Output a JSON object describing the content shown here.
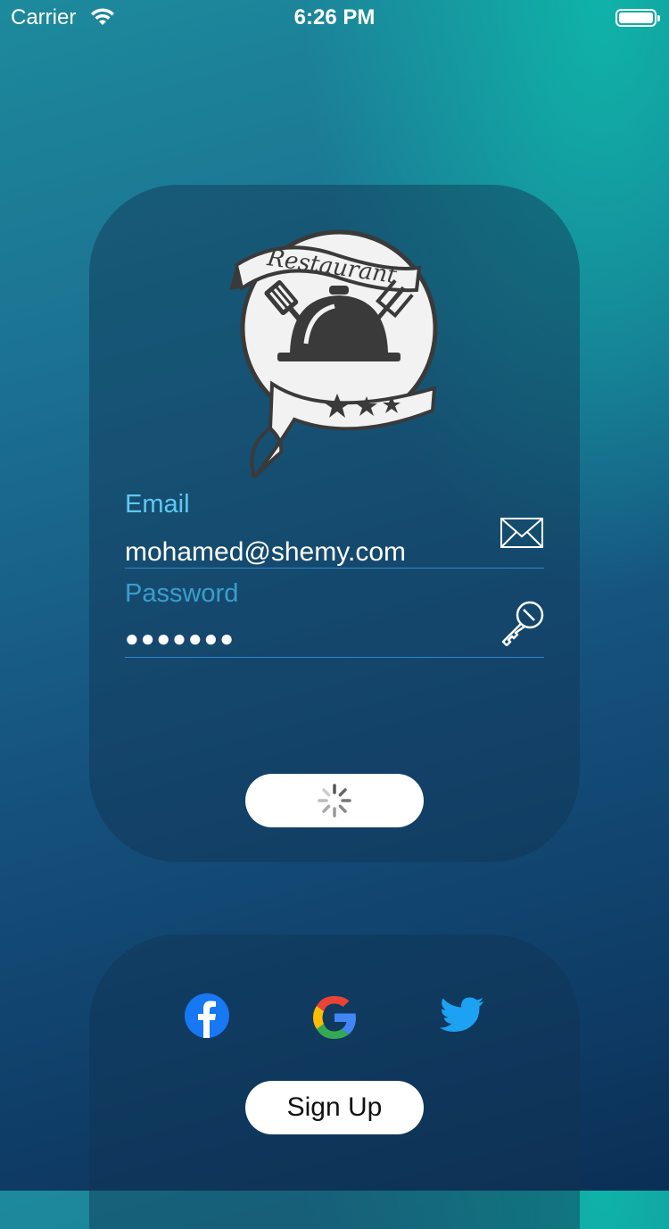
{
  "status_bar": {
    "carrier": "Carrier",
    "time": "6:26 PM"
  },
  "logo": {
    "icon": "restaurant-logo",
    "text": "Restaurant"
  },
  "login": {
    "email_label": "Email",
    "email_value": "mohamed@shemy.com",
    "password_label": "Password",
    "password_value": "●●●●●●●",
    "email_icon": "envelope-icon",
    "password_icon": "key-icon",
    "login_button_state": "loading-spinner"
  },
  "social": {
    "icons": [
      "facebook-icon",
      "google-icon",
      "twitter-icon"
    ],
    "signup_label": "Sign Up"
  },
  "colors": {
    "label_accent": "#5ec8f2",
    "underline": "#2f86d2",
    "facebook": "#1877f2",
    "twitter": "#1da1f2"
  }
}
